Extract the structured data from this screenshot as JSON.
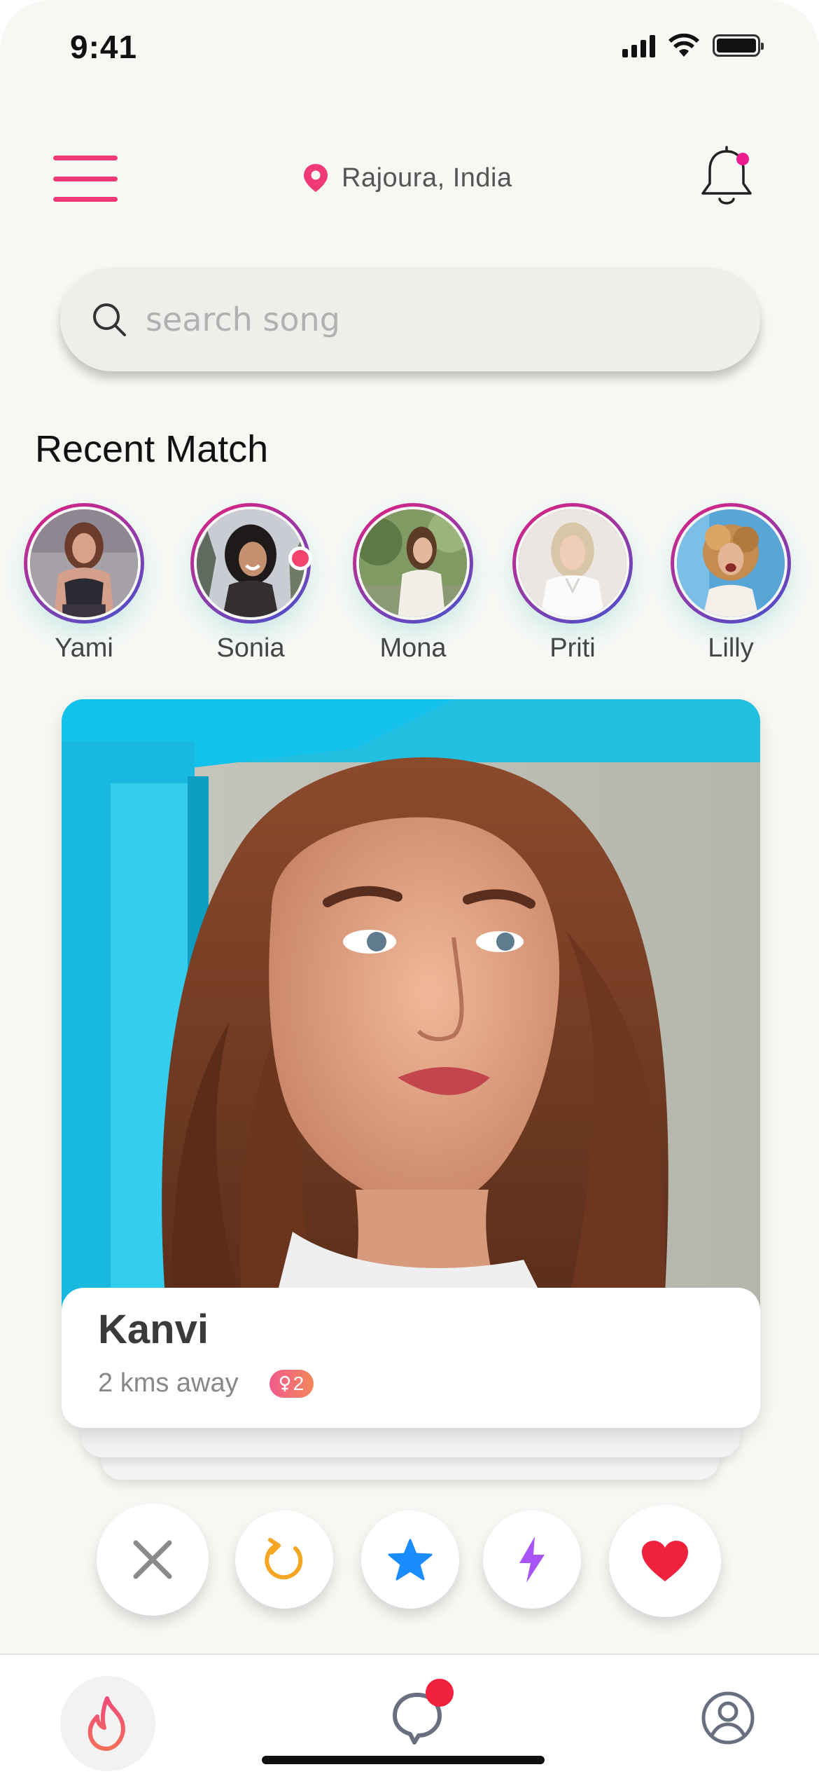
{
  "status_bar": {
    "time": "9:41"
  },
  "header": {
    "menu_icon": "hamburger-icon",
    "location": "Rajoura, India",
    "location_icon": "map-pin-icon",
    "notification_icon": "bell-icon",
    "accent_color": "#f03a78"
  },
  "search": {
    "placeholder": "search song",
    "value": ""
  },
  "recent_match": {
    "title": "Recent Match",
    "profiles": [
      {
        "name": "Yami",
        "online": false
      },
      {
        "name": "Sonia",
        "online": true
      },
      {
        "name": "Mona",
        "online": false
      },
      {
        "name": "Priti",
        "online": false
      },
      {
        "name": "Lilly",
        "online": false
      }
    ]
  },
  "card": {
    "name": "Kanvi",
    "distance": "2 kms away",
    "badge": "2",
    "badge_icon": "female-icon"
  },
  "actions": [
    {
      "name": "dislike",
      "icon": "close-icon",
      "color": "#8a8a8a"
    },
    {
      "name": "rewind",
      "icon": "refresh-icon",
      "color": "#f5a623"
    },
    {
      "name": "super-like",
      "icon": "star-icon",
      "color": "#1a8cff"
    },
    {
      "name": "boost",
      "icon": "lightning-icon",
      "color": "#a855f7"
    },
    {
      "name": "like",
      "icon": "heart-icon",
      "color": "#f0213d"
    }
  ],
  "bottom_nav": [
    {
      "name": "discover",
      "icon": "flame-icon",
      "active": true
    },
    {
      "name": "chat",
      "icon": "chat-icon",
      "active": false,
      "has_notification": true
    },
    {
      "name": "profile",
      "icon": "user-icon",
      "active": false
    }
  ]
}
